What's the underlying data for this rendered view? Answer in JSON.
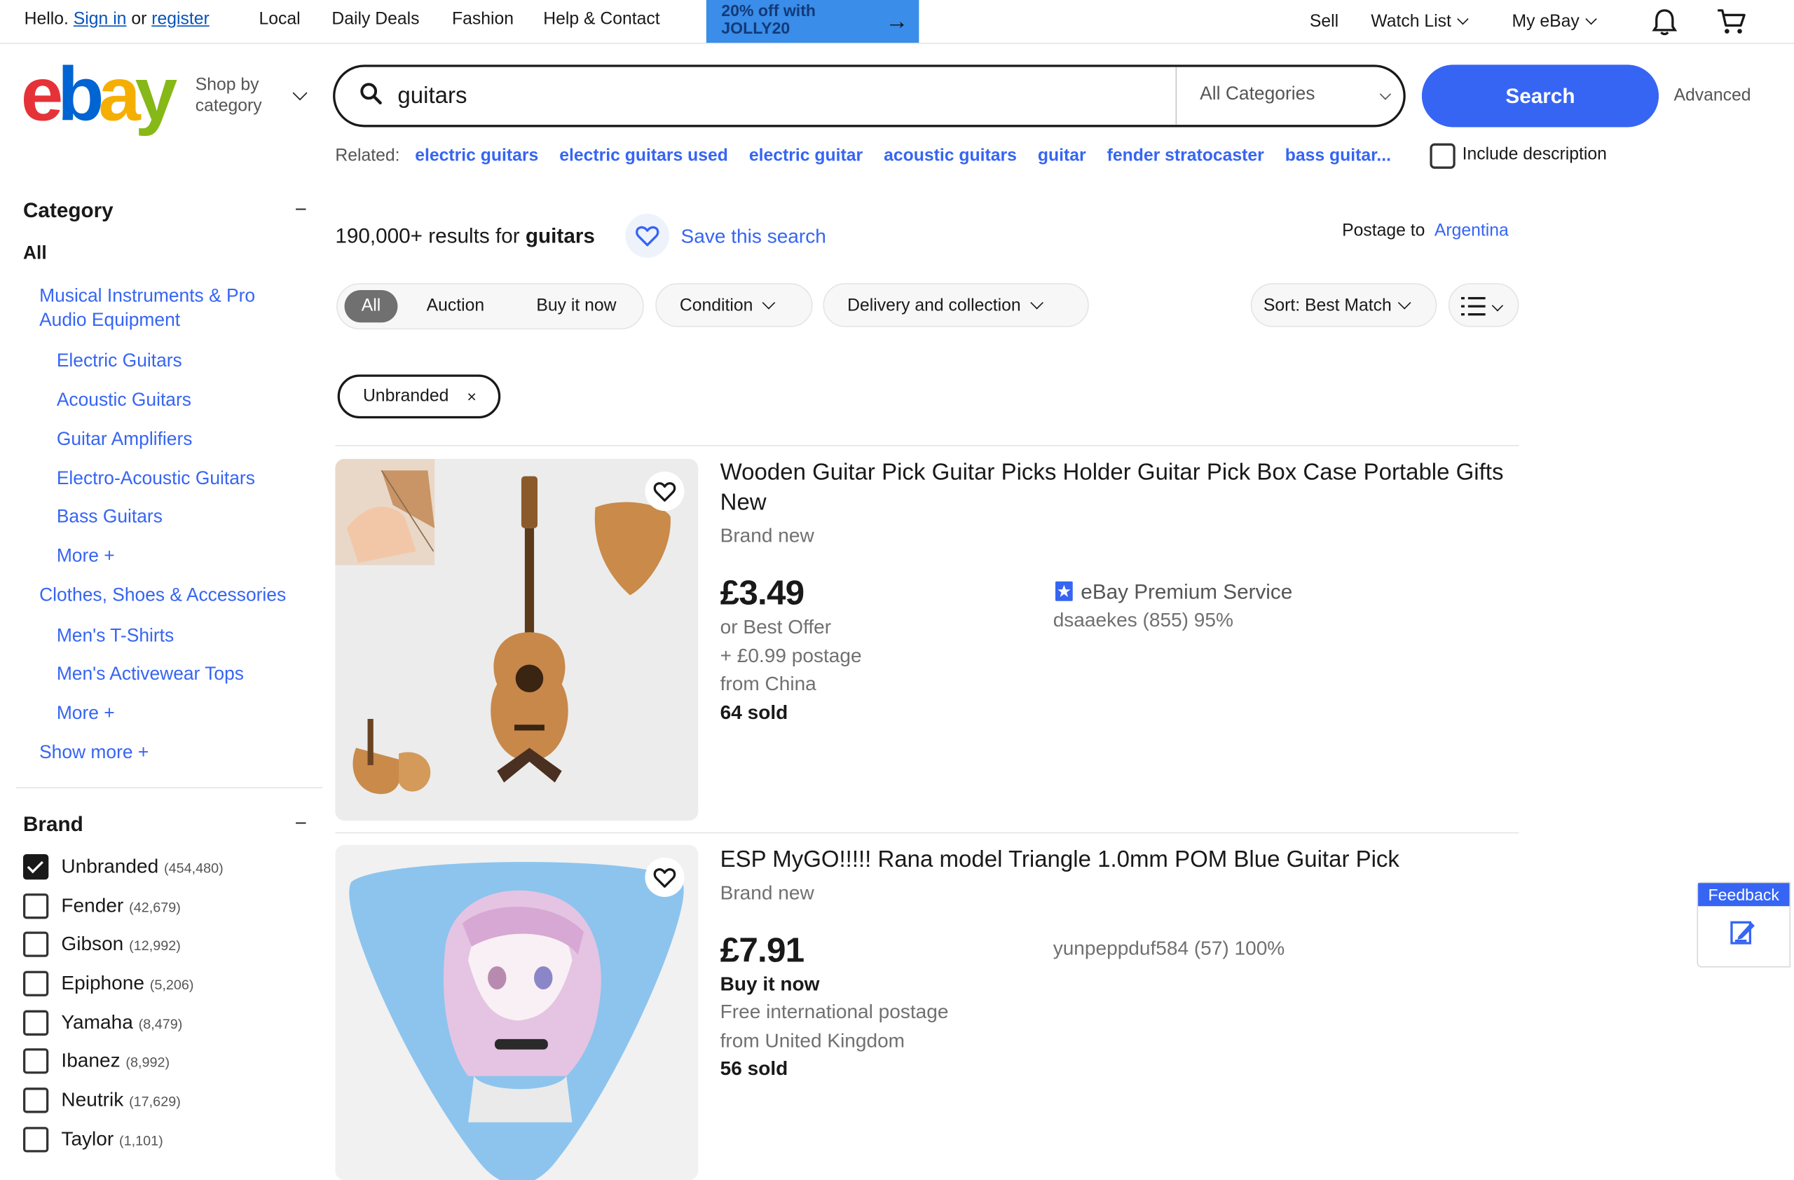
{
  "topbar": {
    "greeting": "Hello.",
    "sign_in": "Sign in",
    "or": "or",
    "register": "register",
    "nav": [
      "Local",
      "Daily Deals",
      "Fashion",
      "Help & Contact"
    ],
    "promo_line1": "20% off with",
    "promo_line2": "JOLLY20",
    "sell": "Sell",
    "watch_list": "Watch List",
    "my_ebay": "My eBay"
  },
  "header": {
    "logo_text": "ebay",
    "shop_by_line1": "Shop by",
    "shop_by_line2": "category",
    "search_value": "guitars",
    "category_select": "All Categories",
    "search_button": "Search",
    "advanced": "Advanced"
  },
  "related": {
    "label": "Related:",
    "links": [
      "electric guitars",
      "electric guitars used",
      "electric guitar",
      "acoustic guitars",
      "guitar",
      "fender stratocaster",
      "bass guitar..."
    ],
    "include_description": "Include description"
  },
  "sidebar": {
    "category_heading": "Category",
    "all": "All",
    "cat1": "Musical Instruments & Pro Audio Equipment",
    "cat1_subs": [
      "Electric Guitars",
      "Acoustic Guitars",
      "Guitar Amplifiers",
      "Electro-Acoustic Guitars",
      "Bass Guitars",
      "More +"
    ],
    "cat2": "Clothes, Shoes & Accessories",
    "cat2_subs": [
      "Men's T-Shirts",
      "Men's Activewear Tops",
      "More +"
    ],
    "show_more": "Show more +",
    "brand_heading": "Brand",
    "brands": [
      {
        "name": "Unbranded",
        "count": "(454,480)",
        "checked": true
      },
      {
        "name": "Fender",
        "count": "(42,679)",
        "checked": false
      },
      {
        "name": "Gibson",
        "count": "(12,992)",
        "checked": false
      },
      {
        "name": "Epiphone",
        "count": "(5,206)",
        "checked": false
      },
      {
        "name": "Yamaha",
        "count": "(8,479)",
        "checked": false
      },
      {
        "name": "Ibanez",
        "count": "(8,992)",
        "checked": false
      },
      {
        "name": "Neutrik",
        "count": "(17,629)",
        "checked": false
      },
      {
        "name": "Taylor",
        "count": "(1,101)",
        "checked": false
      }
    ]
  },
  "results": {
    "count_prefix": "190,000+ results for",
    "query": "guitars",
    "save_search": "Save this search",
    "postage_to_label": "Postage to",
    "postage_country": "Argentina"
  },
  "filters": {
    "format_all": "All",
    "format_auction": "Auction",
    "format_buy": "Buy it now",
    "condition": "Condition",
    "delivery": "Delivery and collection",
    "sort": "Sort: Best Match",
    "active_chip": "Unbranded",
    "chip_remove": "×"
  },
  "listings": [
    {
      "title": "Wooden Guitar Pick Guitar Picks Holder Guitar Pick Box Case Portable Gifts New",
      "condition": "Brand new",
      "price": "£3.49",
      "offer": "or Best Offer",
      "postage": "+ £0.99 postage",
      "origin": "from China",
      "sold": "64 sold",
      "badge": "eBay Premium Service",
      "seller": "dsaaekes (855) 95%"
    },
    {
      "title": "ESP MyGO!!!!! Rana model Triangle 1.0mm POM Blue Guitar Pick",
      "condition": "Brand new",
      "price": "£7.91",
      "buy_format": "Buy it now",
      "postage": "Free international postage",
      "origin": "from United Kingdom",
      "sold": "56 sold",
      "seller": "yunpeppduf584 (57) 100%"
    }
  ],
  "feedback": {
    "label": "Feedback"
  },
  "colors": {
    "accent": "#3665f3",
    "text": "#191919",
    "muted": "#707070"
  }
}
